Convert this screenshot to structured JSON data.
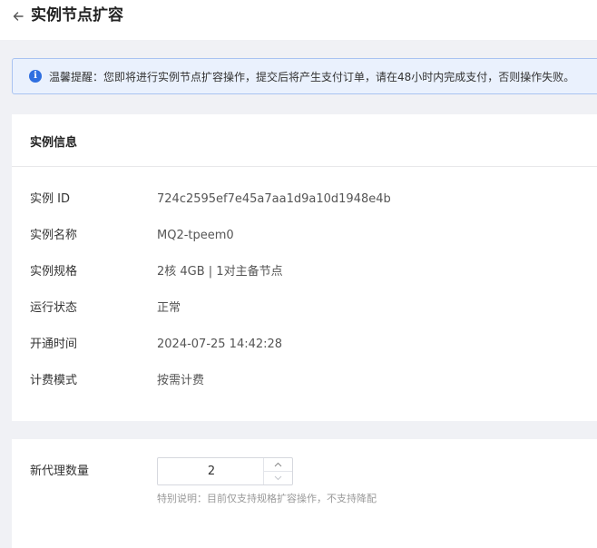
{
  "header": {
    "title": "实例节点扩容"
  },
  "notice": {
    "text": "温馨提醒：您即将进行实例节点扩容操作，提交后将产生支付订单，请在48小时内完成支付，否则操作失败。"
  },
  "instance_info": {
    "title": "实例信息",
    "rows": [
      {
        "label": "实例 ID",
        "value": "724c2595ef7e45a7aa1d9a10d1948e4b"
      },
      {
        "label": "实例名称",
        "value": "MQ2-tpeem0"
      },
      {
        "label": "实例规格",
        "value": "2核 4GB | 1对主备节点"
      },
      {
        "label": "运行状态",
        "value": "正常"
      },
      {
        "label": "开通时间",
        "value": "2024-07-25 14:42:28"
      },
      {
        "label": "计费模式",
        "value": "按需计费"
      }
    ]
  },
  "scale": {
    "label": "新代理数量",
    "value": "2",
    "hint": "特别说明：目前仅支持规格扩容操作，不支持降配"
  }
}
